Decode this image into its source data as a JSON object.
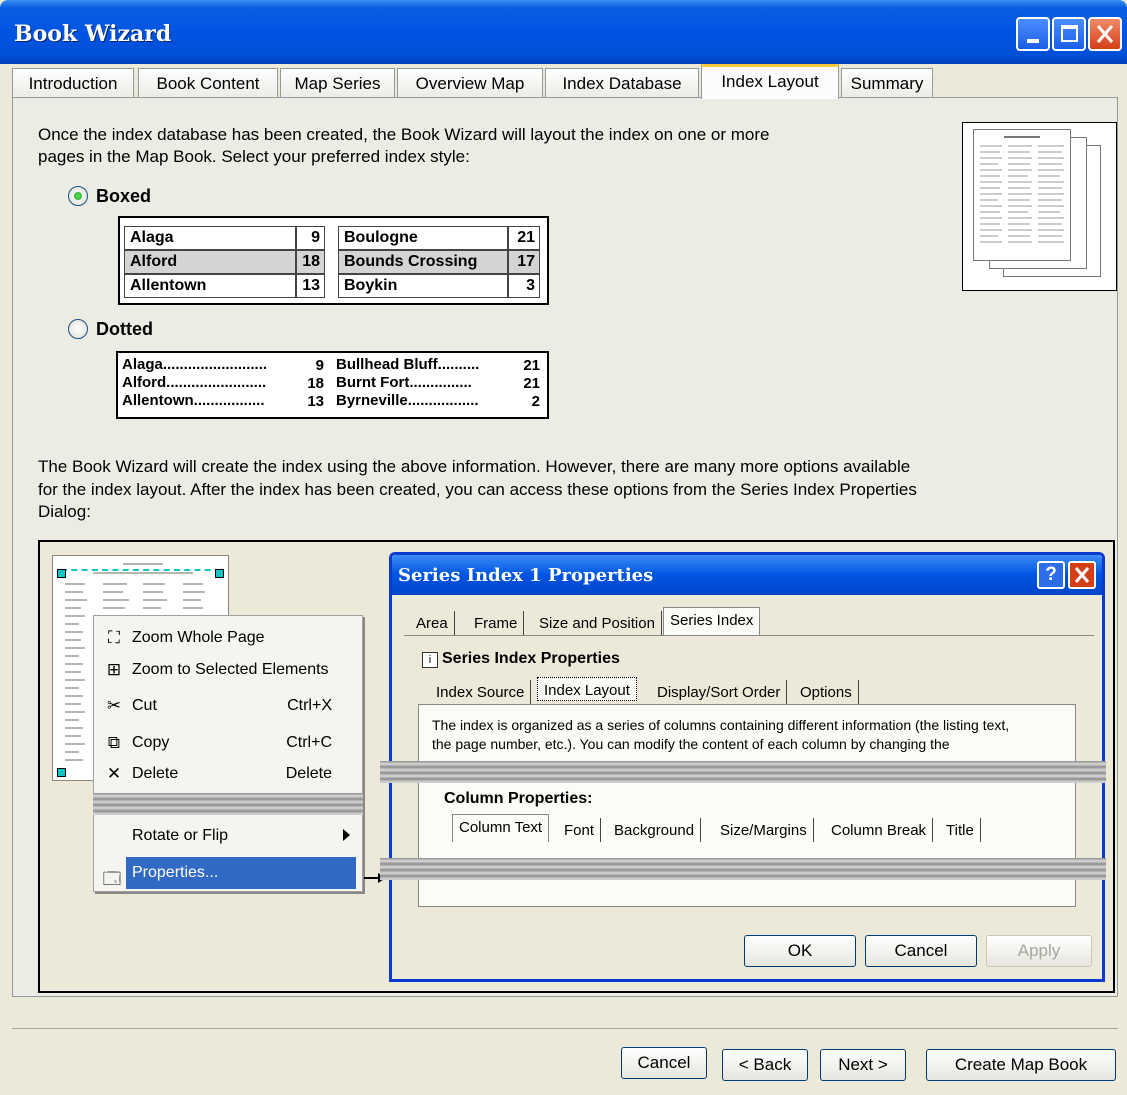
{
  "window": {
    "title": "Book Wizard",
    "colors": {
      "titlebar": "#0054e3",
      "close": "#d43f17",
      "tab_highlight": "#ffc83c",
      "selection": "#316ac5"
    }
  },
  "tabs": [
    "Introduction",
    "Book Content",
    "Map Series",
    "Overview Map",
    "Index Database",
    "Index Layout",
    "Summary"
  ],
  "active_tab": "Index Layout",
  "intro": {
    "line1": "Once the index database has been created, the Book Wizard will layout the index on one or more",
    "line2": "pages in the Map Book.  Select your preferred index style:"
  },
  "options": {
    "boxed": {
      "label": "Boxed",
      "selected": true
    },
    "dotted": {
      "label": "Dotted",
      "selected": false
    }
  },
  "boxed_sample": {
    "left": [
      {
        "name": "Alaga",
        "page": "9"
      },
      {
        "name": "Alford",
        "page": "18"
      },
      {
        "name": "Allentown",
        "page": "13"
      }
    ],
    "right": [
      {
        "name": "Boulogne",
        "page": "21"
      },
      {
        "name": "Bounds Crossing",
        "page": "17"
      },
      {
        "name": "Boykin",
        "page": "3"
      }
    ]
  },
  "dotted_sample": {
    "left": [
      {
        "name": "Alaga.........................",
        "page": "9"
      },
      {
        "name": "Alford........................",
        "page": "18"
      },
      {
        "name": "Allentown.................",
        "page": "13"
      }
    ],
    "right": [
      {
        "name": "Bullhead Bluff..........",
        "page": "21"
      },
      {
        "name": "Burnt Fort...............",
        "page": "21"
      },
      {
        "name": "Byrneville.................",
        "page": "2"
      }
    ]
  },
  "info": {
    "line1": "The Book Wizard will create the index using the above information.  However, there are many more options available",
    "line2": "for the index layout.  After the index has been created, you can access these options from the Series Index Properties",
    "line3": "Dialog:"
  },
  "context_menu": {
    "zoom_whole": "Zoom Whole Page",
    "zoom_selected": "Zoom to Selected Elements",
    "cut": "Cut",
    "cut_key": "Ctrl+X",
    "copy": "Copy",
    "copy_key": "Ctrl+C",
    "delete": "Delete",
    "delete_key": "Delete",
    "rotate": "Rotate or Flip",
    "properties": "Properties..."
  },
  "dialog": {
    "title": "Series Index 1 Properties",
    "tabs": [
      "Area",
      "Frame",
      "Size and Position",
      "Series Index"
    ],
    "group_label": "Series Index Properties",
    "subtabs": [
      "Index Source",
      "Index Layout",
      "Display/Sort Order",
      "Options"
    ],
    "desc1": "The index is organized as a series of columns containing different information (the listing text,",
    "desc2": "the page number, etc.).  You can modify the content of each column by changing the",
    "column_props": "Column Properties:",
    "coltabs": [
      "Column Text",
      "Font",
      "Background",
      "Size/Margins",
      "Column Break",
      "Title"
    ],
    "ok": "OK",
    "cancel": "Cancel",
    "apply": "Apply"
  },
  "footer": {
    "cancel": "Cancel",
    "back": "< Back",
    "next": "Next >",
    "create": "Create Map Book"
  }
}
